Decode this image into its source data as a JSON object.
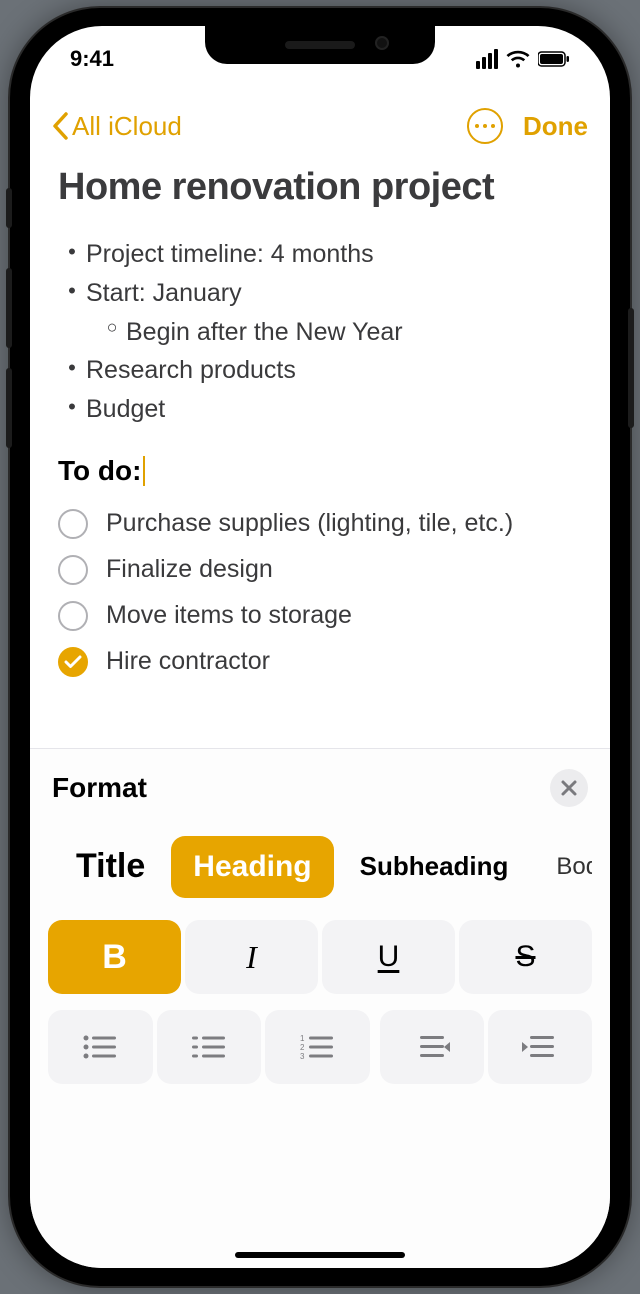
{
  "status": {
    "time": "9:41"
  },
  "nav": {
    "back_label": "All iCloud",
    "done_label": "Done"
  },
  "note": {
    "title": "Home renovation project",
    "bullets": [
      {
        "text": "Project timeline: 4 months",
        "level": 0
      },
      {
        "text": "Start: January",
        "level": 0
      },
      {
        "text": "Begin after the New Year",
        "level": 1
      },
      {
        "text": "Research products",
        "level": 0
      },
      {
        "text": "Budget",
        "level": 0
      }
    ],
    "heading": "To do:",
    "checklist": [
      {
        "text": "Purchase supplies (lighting, tile, etc.)",
        "done": false
      },
      {
        "text": "Finalize design",
        "done": false
      },
      {
        "text": "Move items to storage",
        "done": false
      },
      {
        "text": "Hire contractor",
        "done": true
      }
    ]
  },
  "panel": {
    "title": "Format",
    "styles": {
      "title": "Title",
      "heading": "Heading",
      "subheading": "Subheading",
      "body": "Body",
      "selected": "heading"
    },
    "inline": {
      "bold": "B",
      "italic": "I",
      "underline": "U",
      "strike": "S",
      "active": "bold"
    }
  },
  "colors": {
    "accent": "#e7a500"
  }
}
